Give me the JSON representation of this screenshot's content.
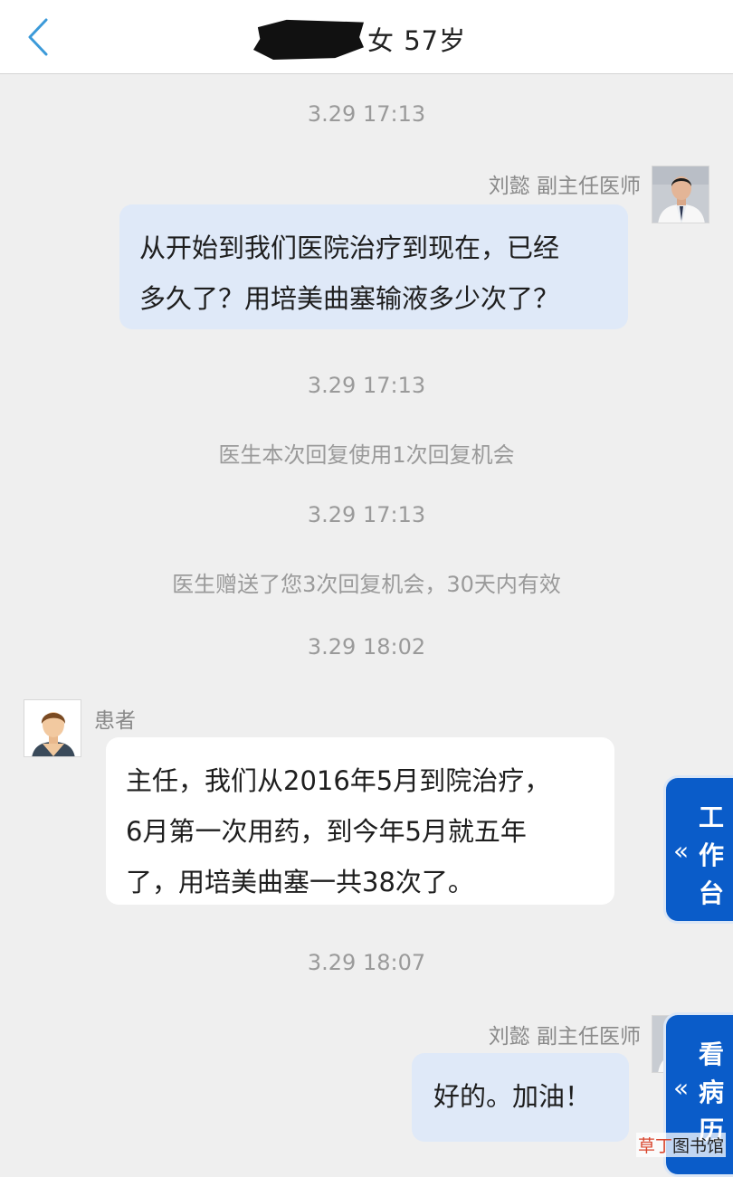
{
  "header": {
    "back_icon": "chevron-left-icon",
    "title": "女 57岁",
    "accent": "#3b9ad9"
  },
  "messages": [
    {
      "time": "3.29 17:13"
    },
    {
      "sender_name": "刘懿 副主任医师",
      "role": "doctor",
      "lines": [
        "从开始到我们医院治疗到现在，已经",
        "多久了？用培美曲塞输液多少次了？"
      ]
    },
    {
      "time": "3.29 17:13"
    },
    {
      "system": "医生本次回复使用1次回复机会"
    },
    {
      "time": "3.29 17:13"
    },
    {
      "system": "医生赠送了您3次回复机会，30天内有效"
    },
    {
      "time": "3.29 18:02"
    },
    {
      "sender_name": "患者",
      "role": "patient",
      "lines": [
        "主任，我们从2016年5月到院治疗，",
        "6月第一次用药，到今年5月就五年",
        "了，用培美曲塞一共38次了。"
      ]
    },
    {
      "time": "3.29 18:07"
    },
    {
      "sender_name": "刘懿 副主任医师",
      "role": "doctor",
      "lines": [
        "好的。加油！"
      ]
    }
  ],
  "side_buttons": {
    "workbench": {
      "arrow": "«",
      "chars": [
        "工",
        "作",
        "台"
      ]
    },
    "records": {
      "arrow": "«",
      "chars": [
        "看",
        "病",
        "历"
      ]
    }
  },
  "watermark": {
    "part1": "草丁",
    "part2": "图书馆"
  },
  "colors": {
    "background": "#efefef",
    "doctor_bubble": "#dfe9f8",
    "patient_bubble": "#ffffff",
    "side_button": "#0a5cc9",
    "meta_text": "#9a9a9a"
  }
}
